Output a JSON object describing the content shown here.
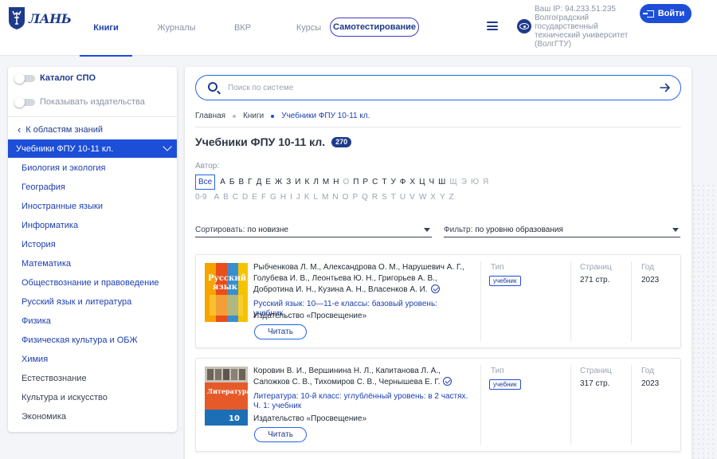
{
  "header": {
    "logo_text": "ЛАНЬ",
    "nav": [
      {
        "label": "Книги",
        "active": true
      },
      {
        "label": "Журналы",
        "active": false
      },
      {
        "label": "ВКР",
        "active": false
      },
      {
        "label": "Курсы",
        "active": false
      }
    ],
    "selftest_label": "Самотестирование",
    "ip_line": "Ваш IP: 94.233.51.235",
    "org_lines": [
      "Волгоградский",
      "государственный",
      "технический университет",
      "(ВолгГТУ)"
    ],
    "login_label": "Войти",
    "accent_color": "#1d4ed8"
  },
  "sidebar": {
    "toggle_spo": "Каталог СПО",
    "toggle_publishers": "Показывать издательства",
    "back_label": "К областям знаний",
    "selected": "Учебники ФПУ 10-11 кл.",
    "items": [
      "Биология и экология",
      "География",
      "Иностранные языки",
      "Информатика",
      "История",
      "Математика",
      "Обществознание и правоведение",
      "Русский язык и литература",
      "Физика",
      "Физическая культура и ОБЖ",
      "Химия",
      "Естествознание",
      "Культура и искусство",
      "Экономика"
    ]
  },
  "search": {
    "placeholder": "Поиск по системе"
  },
  "breadcrumb": [
    "Главная",
    "Книги",
    "Учебники ФПУ 10-11 кл."
  ],
  "page": {
    "title": "Учебники ФПУ 10-11 кл.",
    "count": "270"
  },
  "author_filter": {
    "label": "Автор:",
    "all": "Все",
    "cyrillic": [
      "А",
      "Б",
      "В",
      "Г",
      "Д",
      "Е",
      "Ж",
      "З",
      "И",
      "К",
      "Л",
      "М",
      "Н",
      "О",
      "П",
      "Р",
      "С",
      "Т",
      "У",
      "Ф",
      "Х",
      "Ц",
      "Ч",
      "Ш",
      "Щ",
      "Э",
      "Ю",
      "Я"
    ],
    "latin": [
      "0-9",
      "A",
      "B",
      "C",
      "D",
      "E",
      "F",
      "G",
      "H",
      "I",
      "J",
      "K",
      "L",
      "M",
      "N",
      "O",
      "P",
      "Q",
      "R",
      "S",
      "T",
      "U",
      "V",
      "W",
      "X",
      "Y",
      "Z"
    ]
  },
  "sort": {
    "label": "Сортировать:",
    "value": "по новизне"
  },
  "filter": {
    "label": "Фильтр:",
    "value": "по уровню образования"
  },
  "meta_labels": {
    "type": "Тип",
    "pages": "Страниц",
    "year": "Год"
  },
  "books": [
    {
      "authors": "Рыбченкова Л. М., Александрова О. М., Нарушевич А. Г., Голубева И. В., Леонтьева Ю. Н., Григорьев А. В., Добротина И. Н., Кузина А. Н., Власенков А. И.",
      "title": "Русский язык: 10—11-е классы: базовый уровень: учебник",
      "publisher": "Издательство «Просвещение»",
      "read_label": "Читать",
      "type": "учебник",
      "pages": "271 стр.",
      "year": "2023",
      "cover_text": "Русский язык"
    },
    {
      "authors": "Коровин В. И., Вершинина Н. Л., Капитанова Л. А., Сапожков С. В., Тихомиров С. В., Чернышева Е. Г.",
      "title": "Литература: 10-й класс: углублённый уровень: в 2 частях. Ч. 1: учебник",
      "publisher": "Издательство «Просвещение»",
      "read_label": "Читать",
      "type": "учебник",
      "pages": "317 стр.",
      "year": "2023",
      "cover_text": "Литература",
      "cover_number": "10"
    }
  ]
}
